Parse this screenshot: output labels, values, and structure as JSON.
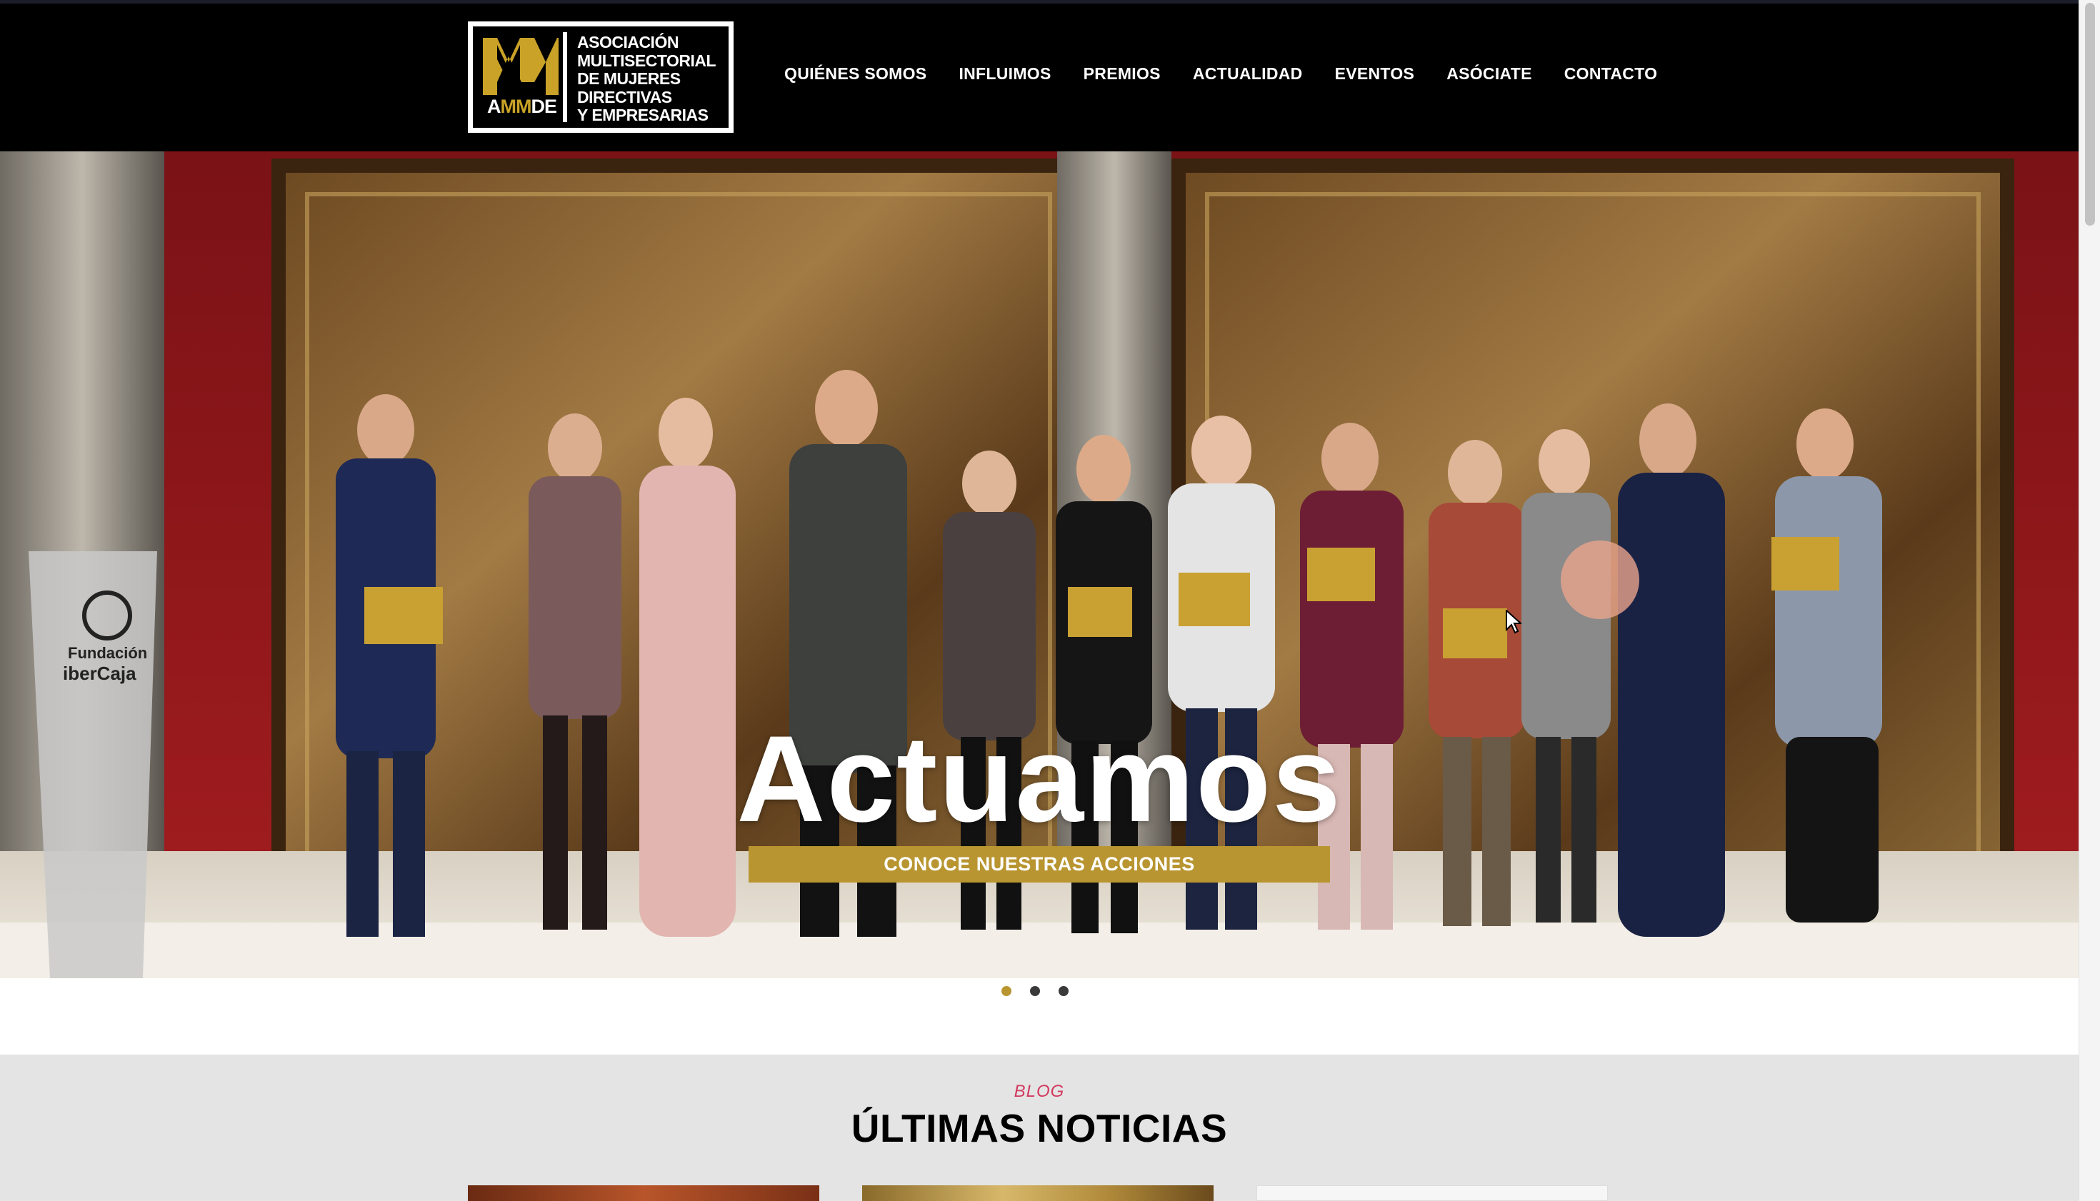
{
  "header": {
    "logo": {
      "abbr_white": "A",
      "abbr_gold": "MM",
      "abbr_rest": "DE",
      "lines": [
        "ASOCIACIÓN",
        "MULTISECTORIAL",
        "DE MUJERES",
        "DIRECTIVAS",
        "Y EMPRESARIAS"
      ]
    },
    "nav": [
      {
        "label": "QUIÉNES SOMOS"
      },
      {
        "label": "INFLUIMOS"
      },
      {
        "label": "PREMIOS"
      },
      {
        "label": "ACTUALIDAD"
      },
      {
        "label": "EVENTOS"
      },
      {
        "label": "ASÓCIATE"
      },
      {
        "label": "CONTACTO"
      }
    ]
  },
  "hero": {
    "title": "Actuamos",
    "cta_label": "CONOCE NUESTRAS ACCIONES",
    "lectern_text_1": "Fundación",
    "lectern_text_2": "iberCaja",
    "slides_total": 3,
    "active_slide": 1
  },
  "blog": {
    "kicker": "BLOG",
    "title": "ÚLTIMAS NOTICIAS"
  },
  "colors": {
    "header_bg": "#000000",
    "brand_gold": "#b8952f",
    "kicker_pink": "#d23a5f",
    "section_grey": "#e4e4e4"
  }
}
